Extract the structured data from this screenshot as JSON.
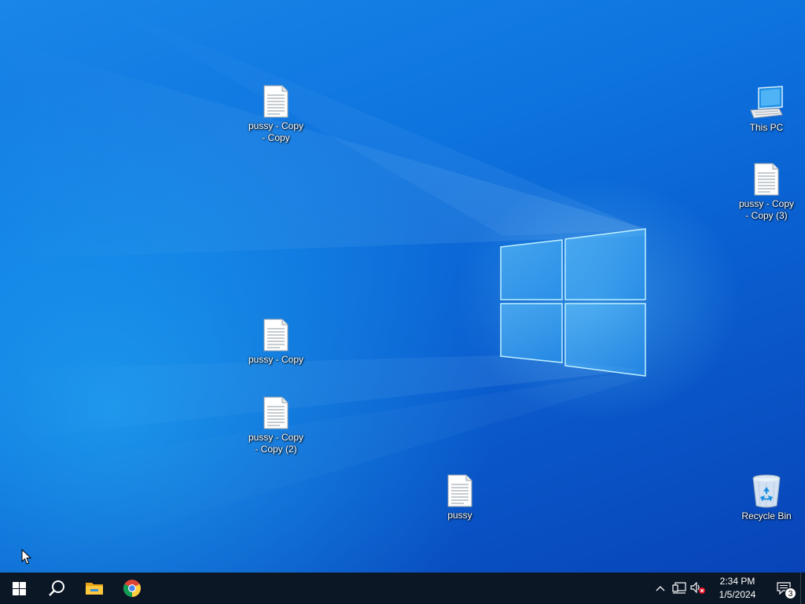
{
  "desktop": {
    "icons": [
      {
        "id": "file-copy-copy",
        "label": "pussy - Copy - Copy",
        "type": "text-file-icon"
      },
      {
        "id": "this-pc",
        "label": "This PC",
        "type": "computer-icon"
      },
      {
        "id": "file-copy-copy-3",
        "label": "pussy - Copy - Copy (3)",
        "type": "text-file-icon"
      },
      {
        "id": "file-copy",
        "label": "pussy - Copy",
        "type": "text-file-icon"
      },
      {
        "id": "file-copy-copy-2",
        "label": "pussy - Copy - Copy (2)",
        "type": "text-file-icon"
      },
      {
        "id": "file",
        "label": "pussy",
        "type": "text-file-icon"
      },
      {
        "id": "recycle-bin",
        "label": "Recycle Bin",
        "type": "recycle-bin-icon"
      }
    ]
  },
  "taskbar": {
    "buttons": [
      {
        "id": "start",
        "icon": "windows-logo-icon"
      },
      {
        "id": "search",
        "icon": "search-icon"
      },
      {
        "id": "file-explorer",
        "icon": "folder-icon"
      },
      {
        "id": "chrome",
        "icon": "chrome-icon"
      }
    ],
    "tray": {
      "icons": [
        "chevron-up-icon",
        "network-icon",
        "speaker-muted-icon"
      ],
      "time": "2:34 PM",
      "date": "1/5/2024",
      "notification_count": "3"
    }
  },
  "colors": {
    "taskbar": "#0c1726",
    "wallpaper_accent": "#0a5fd0",
    "active_indicator": "#76b9ed"
  }
}
